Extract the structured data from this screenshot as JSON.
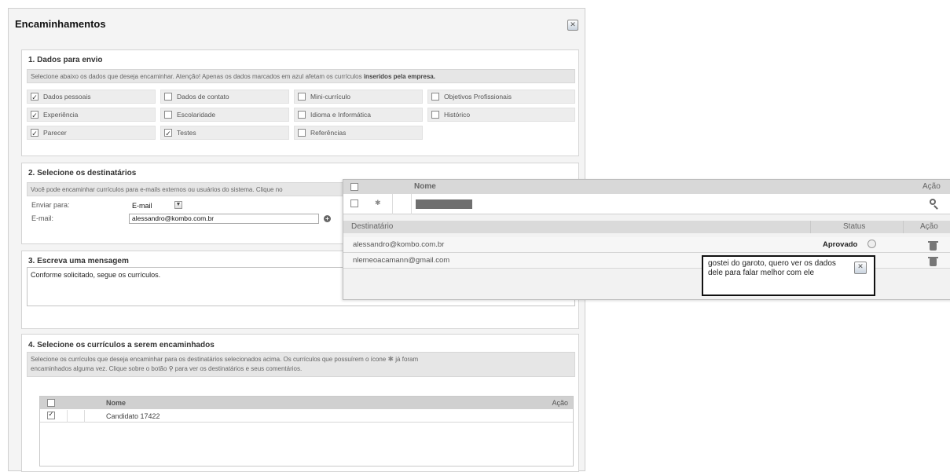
{
  "window": {
    "title": "Encaminhamentos"
  },
  "section1": {
    "title": "1. Dados para envio",
    "info_text": "Selecione abaixo os dados que deseja encaminhar. Atenção! Apenas os dados marcados em azul afetam os currículos",
    "info_bold": "inseridos pela empresa.",
    "options": [
      {
        "label": "Dados pessoais",
        "checked": true
      },
      {
        "label": "Dados de contato",
        "checked": false
      },
      {
        "label": "Mini-currículo",
        "checked": false
      },
      {
        "label": "Objetivos Profissionais",
        "checked": false
      },
      {
        "label": "Experiência",
        "checked": true
      },
      {
        "label": "Escolaridade",
        "checked": false
      },
      {
        "label": "Idioma e Informática",
        "checked": false
      },
      {
        "label": "Histórico",
        "checked": false
      },
      {
        "label": "Parecer",
        "checked": true
      },
      {
        "label": "Testes",
        "checked": true
      },
      {
        "label": "Referências",
        "checked": false
      }
    ]
  },
  "section2": {
    "title": "2. Selecione os destinatários",
    "info_text": "Você pode encaminhar currículos para e-mails externos ou usuários do sistema. Clique no",
    "send_to_label": "Enviar para:",
    "send_to_value": "E-mail",
    "email_label": "E-mail:",
    "email_value": "alessandro@kombo.com.br"
  },
  "section3": {
    "title": "3. Escreva uma mensagem",
    "message": "Conforme solicitado, segue os currículos."
  },
  "section4": {
    "title": "4. Selecione os currículos a serem encaminhados",
    "info_line1_a": "Selecione os currículos que deseja encaminhar para os destinatários selecionados acima. Os currículos que possuírem o ícone",
    "info_line1_b": "já foram",
    "info_line2_a": "encaminhados alguma vez. Clique sobre o botão",
    "info_line2_b": "para ver os destinatários e seus comentários.",
    "col_name": "Nome",
    "col_action": "Ação",
    "rows": [
      {
        "name": "Candidato 17422",
        "checked": true
      }
    ]
  },
  "popup": {
    "col_name": "Nome",
    "col_action": "Ação",
    "dest_header": "Destinatário",
    "status_header": "Status",
    "action_header": "Ação",
    "recipients": [
      {
        "email": "alessandro@kombo.com.br",
        "status": "Aprovado"
      },
      {
        "email": "nlemeoacamann@gmail.com",
        "status": ""
      }
    ],
    "comment": "gostei do garoto, quero ver os dados dele para falar melhor com ele"
  }
}
